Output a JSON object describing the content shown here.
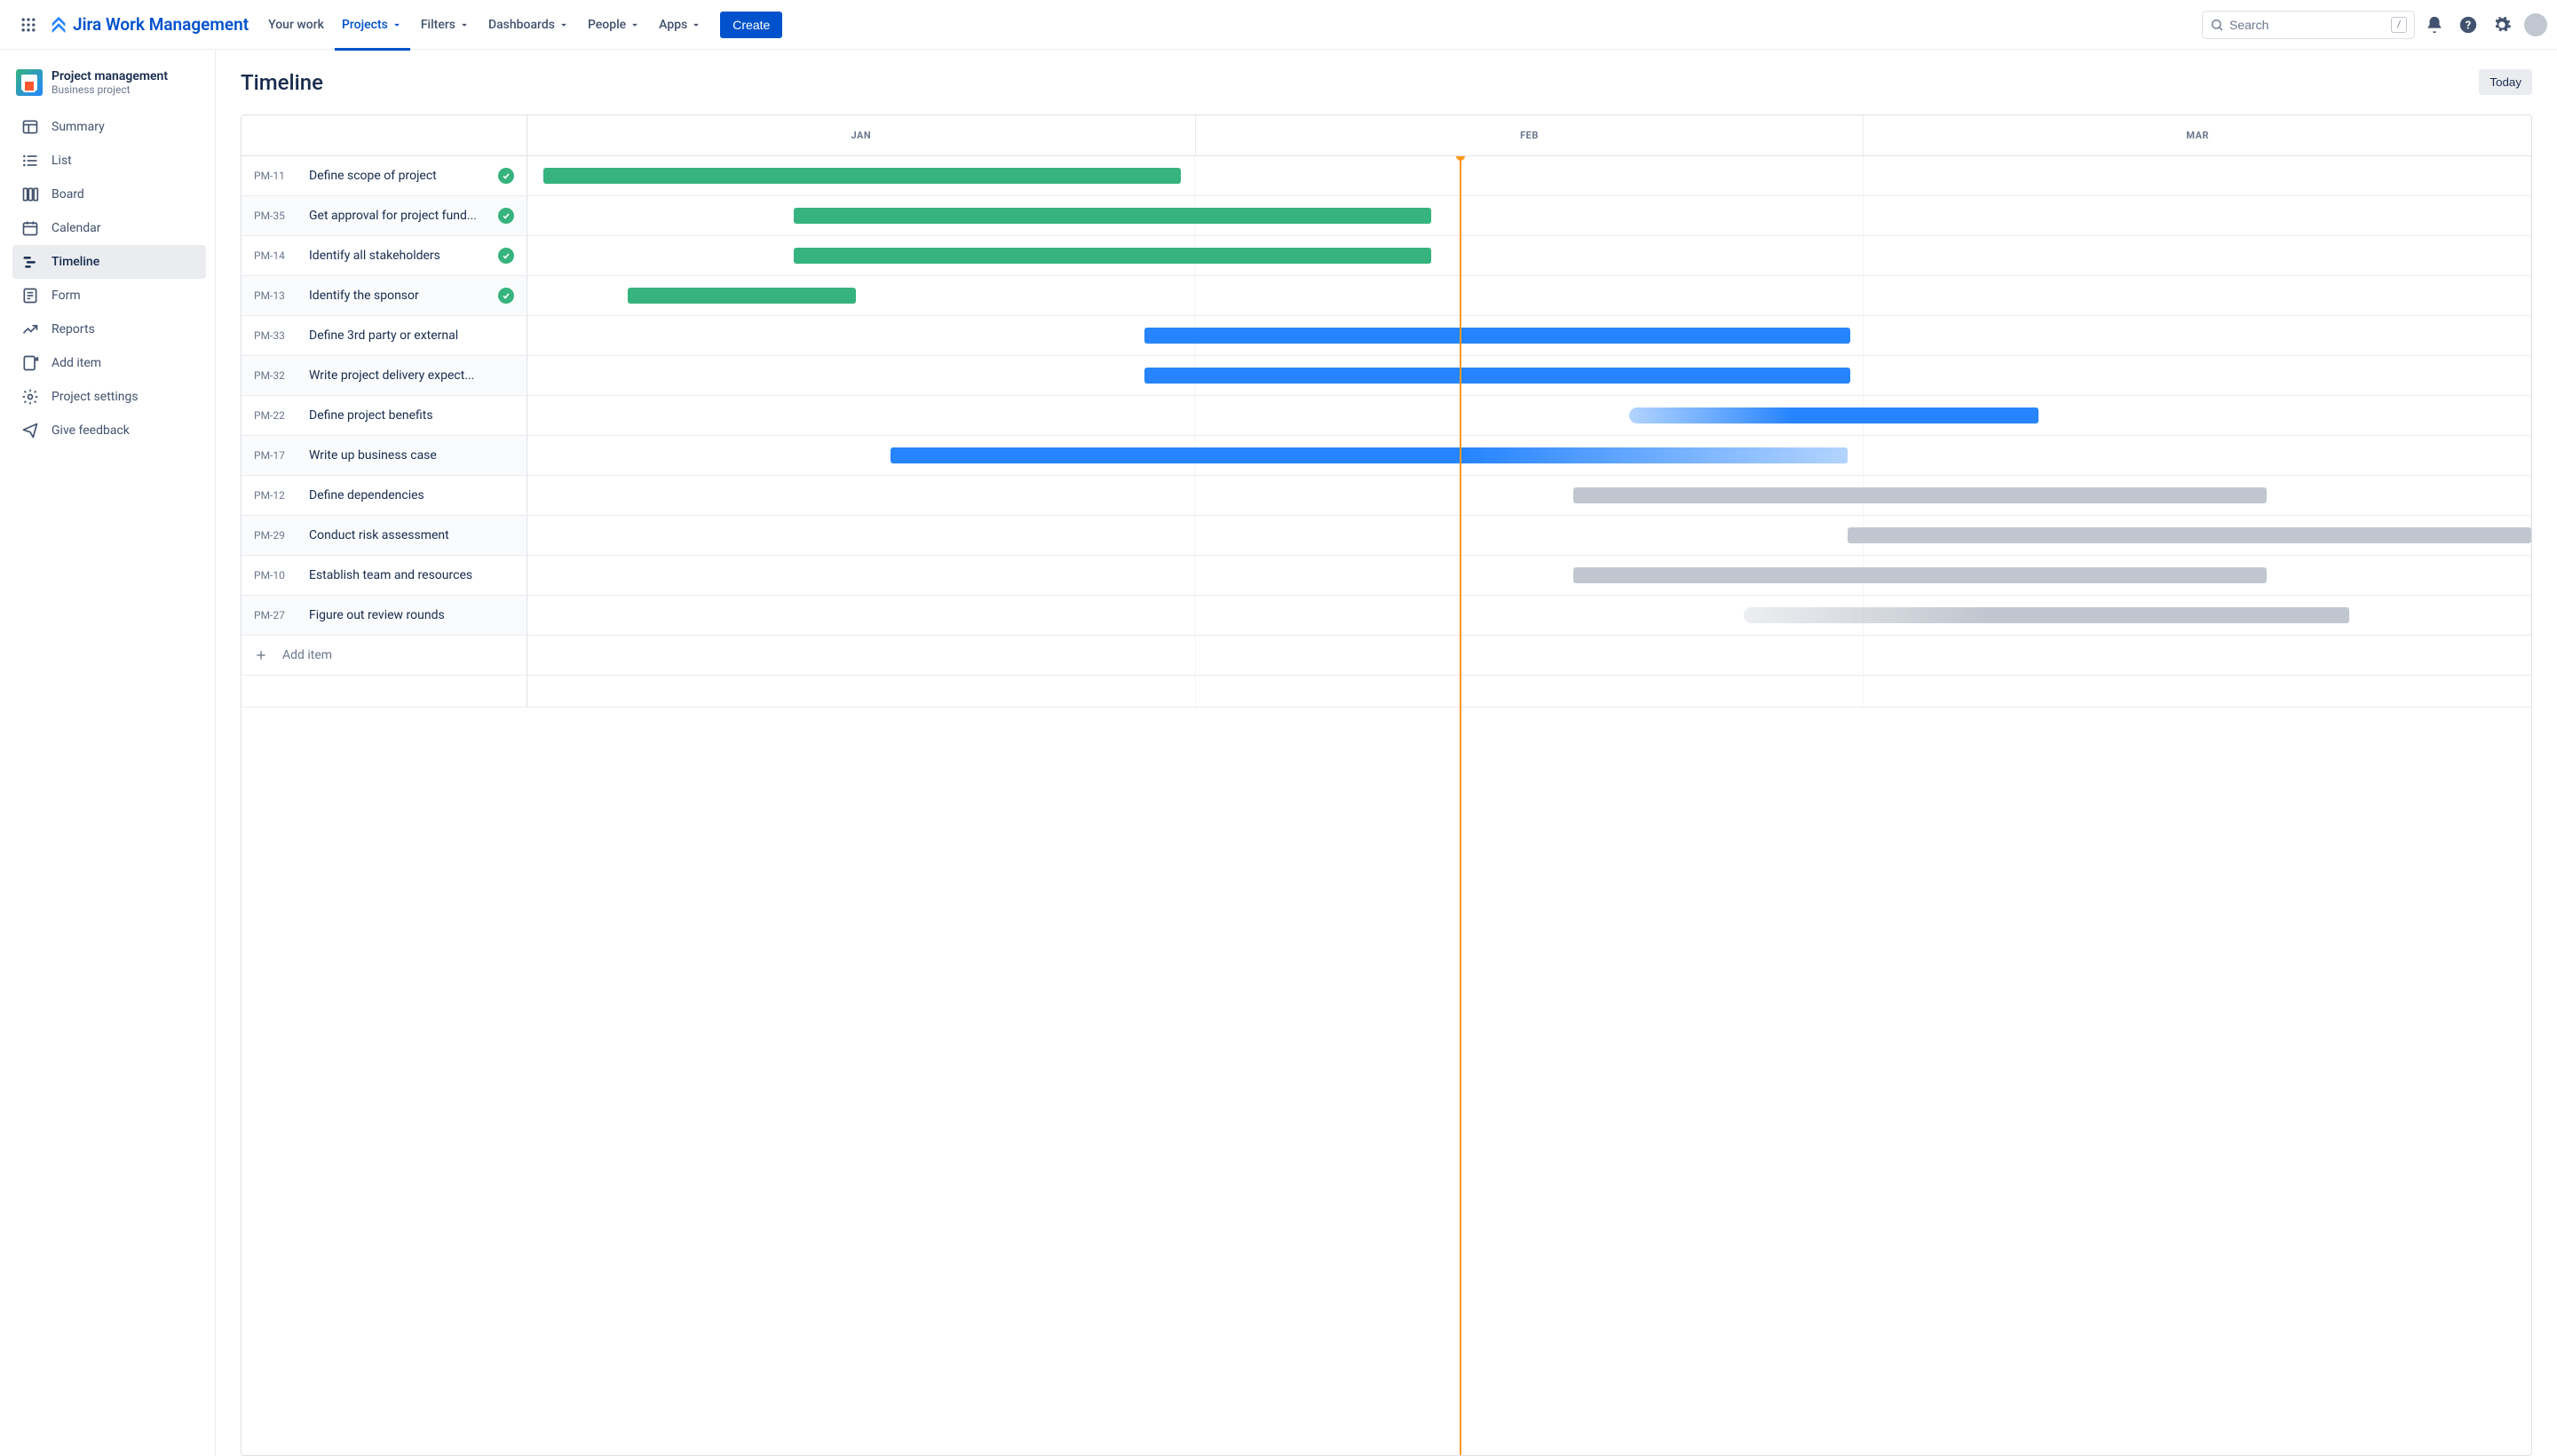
{
  "product_name": "Jira Work Management",
  "topnav": {
    "items": [
      "Your work",
      "Projects",
      "Filters",
      "Dashboards",
      "People",
      "Apps"
    ],
    "active_index": 1,
    "create_label": "Create",
    "search_placeholder": "Search",
    "search_key": "/"
  },
  "project": {
    "name": "Project management",
    "type": "Business project"
  },
  "sidebar": {
    "items": [
      {
        "label": "Summary",
        "icon": "layout"
      },
      {
        "label": "List",
        "icon": "list"
      },
      {
        "label": "Board",
        "icon": "board"
      },
      {
        "label": "Calendar",
        "icon": "calendar"
      },
      {
        "label": "Timeline",
        "icon": "timeline",
        "active": true
      },
      {
        "label": "Form",
        "icon": "form"
      },
      {
        "label": "Reports",
        "icon": "reports"
      },
      {
        "label": "Add item",
        "icon": "add-item"
      },
      {
        "label": "Project settings",
        "icon": "settings"
      },
      {
        "label": "Give feedback",
        "icon": "feedback"
      }
    ]
  },
  "page": {
    "title": "Timeline",
    "today_label": "Today",
    "add_item_label": "Add item"
  },
  "timeline": {
    "months": [
      "JAN",
      "FEB",
      "MAR"
    ],
    "today_position_pct": 46.5,
    "rows": [
      {
        "key": "PM-11",
        "title": "Define scope of project",
        "done": true,
        "bar": {
          "start": 0.8,
          "width": 31.8,
          "color": "green"
        }
      },
      {
        "key": "PM-35",
        "title": "Get approval for project fund...",
        "done": true,
        "bar": {
          "start": 13.3,
          "width": 31.8,
          "color": "green"
        }
      },
      {
        "key": "PM-14",
        "title": "Identify all stakeholders",
        "done": true,
        "bar": {
          "start": 13.3,
          "width": 31.8,
          "color": "green"
        }
      },
      {
        "key": "PM-13",
        "title": "Identify the sponsor",
        "done": true,
        "bar": {
          "start": 5.0,
          "width": 11.4,
          "color": "green"
        }
      },
      {
        "key": "PM-33",
        "title": "Define 3rd party or external",
        "done": false,
        "bar": {
          "start": 30.8,
          "width": 35.2,
          "color": "blue"
        }
      },
      {
        "key": "PM-32",
        "title": "Write project delivery expect...",
        "done": false,
        "bar": {
          "start": 30.8,
          "width": 35.2,
          "color": "blue"
        }
      },
      {
        "key": "PM-22",
        "title": "Define project benefits",
        "done": false,
        "bar": {
          "start": 55.0,
          "width": 20.4,
          "color": "blue-grad-rev"
        }
      },
      {
        "key": "PM-17",
        "title": "Write up business case",
        "done": false,
        "bar": {
          "start": 18.1,
          "width": 47.8,
          "color": "blue-grad"
        }
      },
      {
        "key": "PM-12",
        "title": "Define dependencies",
        "done": false,
        "bar": {
          "start": 52.2,
          "width": 34.6,
          "color": "gray"
        }
      },
      {
        "key": "PM-29",
        "title": "Conduct risk assessment",
        "done": false,
        "bar": {
          "start": 65.9,
          "width": 34.1,
          "color": "gray"
        }
      },
      {
        "key": "PM-10",
        "title": "Establish team and resources",
        "done": false,
        "bar": {
          "start": 52.2,
          "width": 34.6,
          "color": "gray"
        }
      },
      {
        "key": "PM-27",
        "title": "Figure out review rounds",
        "done": false,
        "bar": {
          "start": 60.7,
          "width": 30.2,
          "color": "gray-grad"
        }
      }
    ]
  }
}
